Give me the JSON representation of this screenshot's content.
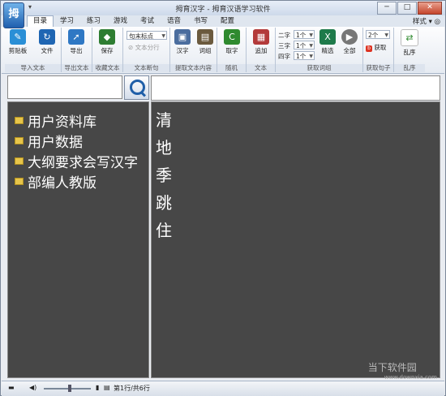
{
  "window": {
    "title": "拇育汉字 - 拇育汉语学习软件",
    "logo_text": "拇",
    "qa_glyph": "▾",
    "btn_min": "─",
    "btn_max": "□",
    "btn_close": "✕"
  },
  "menu": {
    "tabs": [
      "目录",
      "学习",
      "练习",
      "游戏",
      "考试",
      "语音",
      "书写",
      "配置"
    ],
    "style": "样式 ▾ ◎"
  },
  "ribbon": {
    "import_group": {
      "label": "导入文本",
      "clipboard": "剪贴板",
      "file": "文件"
    },
    "export_group": {
      "label": "导出文本",
      "export": "导出"
    },
    "fav_group": {
      "label": "收藏文本",
      "save": "保存"
    },
    "break_group": {
      "label": "文本断句",
      "combo": "句末标点",
      "split": "文本分行"
    },
    "extract_group": {
      "label": "提取文本内容",
      "hanzi": "汉字",
      "words": "词组"
    },
    "random_group": {
      "label": "随机",
      "take": "取字"
    },
    "text_group": {
      "label": "文本",
      "append": "追加"
    },
    "words_group": {
      "label": "获取词组",
      "row1": "二字",
      "row1_val": "1个",
      "row2": "三字",
      "row2_val": "1个",
      "row3": "四字",
      "row3_val": "1个",
      "select": "精选",
      "all": "全部"
    },
    "sentence_group": {
      "label": "获取句子",
      "count": "2个",
      "fetch": "获取"
    },
    "shuffle_group": {
      "label": "乱序",
      "shuffle": "乱序"
    }
  },
  "search": {
    "placeholder": ""
  },
  "tree": [
    "用户资料库",
    "用户数据",
    "大纲要求会写汉字",
    "部编人教版"
  ],
  "characters": [
    "清",
    "地",
    "季",
    "跳",
    "住"
  ],
  "status": {
    "position": "第1行/共6行"
  },
  "watermark": {
    "text": "当下软件园",
    "url": "www.downxia.com"
  }
}
